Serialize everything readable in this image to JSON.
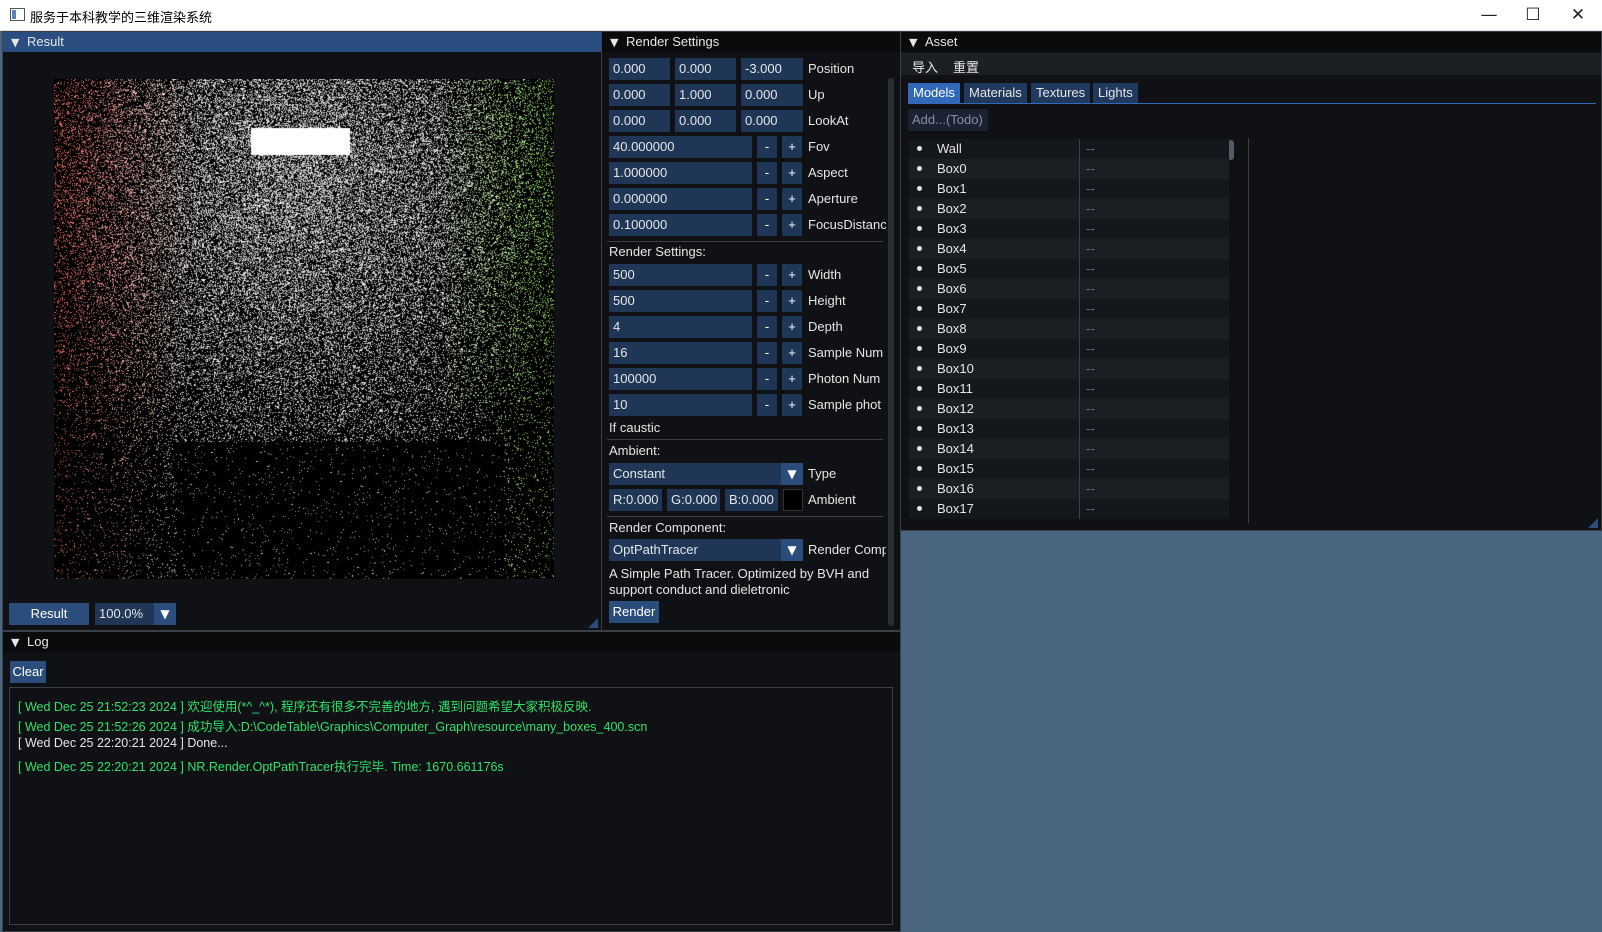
{
  "window": {
    "title": "服务于本科教学的三维渲染系统",
    "min": "—",
    "max": "☐",
    "close": "✕"
  },
  "result_panel": {
    "title": "Result",
    "button": "Result",
    "zoom": "100.0%"
  },
  "render_settings": {
    "title": "Render Settings",
    "position": {
      "x": "0.000",
      "y": "0.000",
      "z": "-3.000",
      "label": "Position"
    },
    "up": {
      "x": "0.000",
      "y": "1.000",
      "z": "0.000",
      "label": "Up"
    },
    "lookat": {
      "x": "0.000",
      "y": "0.000",
      "z": "0.000",
      "label": "LookAt"
    },
    "camera_params": [
      {
        "value": "40.000000",
        "label": "Fov"
      },
      {
        "value": "1.000000",
        "label": "Aspect"
      },
      {
        "value": "0.000000",
        "label": "Aperture"
      },
      {
        "value": "0.100000",
        "label": "FocusDistanc"
      }
    ],
    "section_label": "Render Settings:",
    "render_params": [
      {
        "value": "500",
        "label": "Width"
      },
      {
        "value": "500",
        "label": "Height"
      },
      {
        "value": "4",
        "label": "Depth"
      },
      {
        "value": "16",
        "label": "Sample Num"
      },
      {
        "value": "100000",
        "label": "Photon Num"
      },
      {
        "value": "10",
        "label": "Sample phot"
      }
    ],
    "minus": "-",
    "plus": "+",
    "if_caustic": "If caustic",
    "ambient_label": "Ambient:",
    "ambient_type": {
      "value": "Constant",
      "label": "Type"
    },
    "ambient_color": {
      "r": "R:0.000",
      "g": "G:0.000",
      "b": "B:0.000",
      "label": "Ambient",
      "swatch": "#000000"
    },
    "component_label": "Render Component:",
    "component": {
      "value": "OptPathTracer",
      "label": "Render Comp"
    },
    "description": "A Simple Path Tracer. Optimized by BVH and support conduct and dieletronic",
    "render_button": "Render"
  },
  "asset": {
    "title": "Asset",
    "menu": [
      "导入",
      "重置"
    ],
    "tabs": [
      "Models",
      "Materials",
      "Textures",
      "Lights"
    ],
    "active_tab": "Models",
    "add_button": "Add...(Todo)",
    "models": [
      {
        "name": "Wall",
        "value": "--"
      },
      {
        "name": "Box0",
        "value": "--"
      },
      {
        "name": "Box1",
        "value": "--"
      },
      {
        "name": "Box2",
        "value": "--"
      },
      {
        "name": "Box3",
        "value": "--"
      },
      {
        "name": "Box4",
        "value": "--"
      },
      {
        "name": "Box5",
        "value": "--"
      },
      {
        "name": "Box6",
        "value": "--"
      },
      {
        "name": "Box7",
        "value": "--"
      },
      {
        "name": "Box8",
        "value": "--"
      },
      {
        "name": "Box9",
        "value": "--"
      },
      {
        "name": "Box10",
        "value": "--"
      },
      {
        "name": "Box11",
        "value": "--"
      },
      {
        "name": "Box12",
        "value": "--"
      },
      {
        "name": "Box13",
        "value": "--"
      },
      {
        "name": "Box14",
        "value": "--"
      },
      {
        "name": "Box15",
        "value": "--"
      },
      {
        "name": "Box16",
        "value": "--"
      },
      {
        "name": "Box17",
        "value": "--"
      }
    ]
  },
  "log": {
    "title": "Log",
    "clear_button": "Clear",
    "lines": [
      {
        "text": "[ Wed Dec 25 21:52:23 2024 ] 欢迎使用(*^_^*), 程序还有很多不完善的地方, 遇到问题希望大家积极反映.",
        "color": "green"
      },
      {
        "text": "[ Wed Dec 25 21:52:26 2024 ] 成功导入:D:\\CodeTable\\Graphics\\Computer_Graph\\resource\\many_boxes_400.scn",
        "color": "green"
      },
      {
        "text": "[ Wed Dec 25 22:20:21 2024 ] Done...",
        "color": "white"
      },
      {
        "text": "[ Wed Dec 25 22:20:21 2024 ] NR.Render.OptPathTracer执行完毕. Time: 1670.661176s",
        "color": "green"
      }
    ]
  },
  "colors": {
    "accent": "#2b4d7c",
    "tab_active": "#3069b8",
    "log_green": "#2ee26a",
    "background": "#4a6680"
  }
}
